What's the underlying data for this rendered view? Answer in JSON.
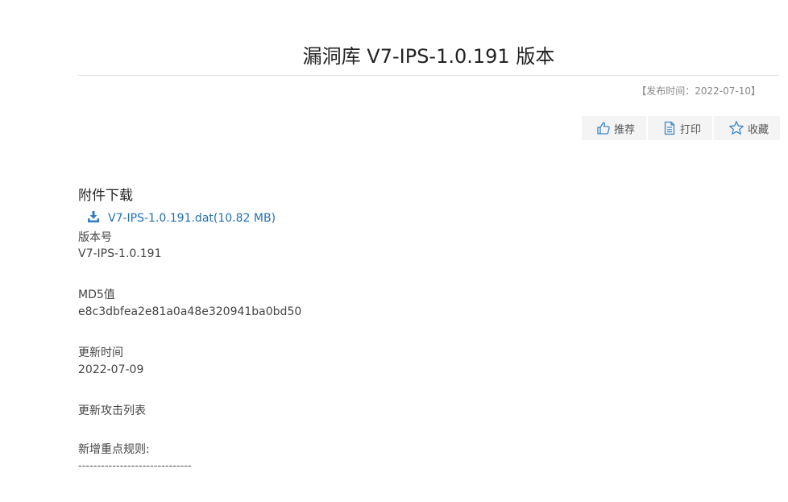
{
  "page": {
    "title": "漏洞库 V7-IPS-1.0.191 版本",
    "publish_time": "【发布时间：2022-07-10】"
  },
  "actions": {
    "recommend": "推荐",
    "print": "打印",
    "favorite": "收藏"
  },
  "attachment": {
    "section_title": "附件下载",
    "file_link": "V7-IPS-1.0.191.dat(10.82 MB)"
  },
  "fields": {
    "version_label": "版本号",
    "version_value": "V7-IPS-1.0.191",
    "md5_label": "MD5值",
    "md5_value": "e8c3dbfea2e81a0a48e320941ba0bd50",
    "update_time_label": "更新时间",
    "update_time_value": "2022-07-09",
    "attack_list_label": "更新攻击列表",
    "new_rules_label": "新增重点规则:",
    "separator": "------------------------------"
  },
  "colors": {
    "link": "#1f6fb5",
    "icon": "#3a86c8"
  }
}
